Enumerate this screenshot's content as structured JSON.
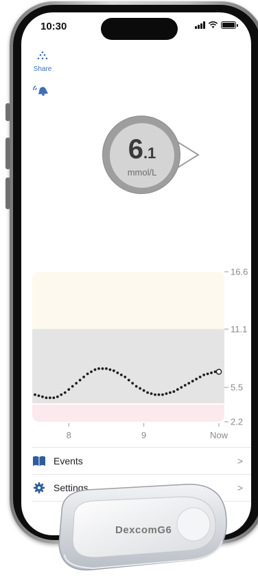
{
  "status": {
    "time": "10:30"
  },
  "share": {
    "label": "Share"
  },
  "reading": {
    "value_int": "6",
    "value_dec": ".1",
    "unit": "mmol/L",
    "trend": "steady"
  },
  "chart_data": {
    "type": "scatter",
    "title": "",
    "xlabel": "",
    "ylabel": "",
    "x_ticks": [
      "8",
      "9",
      "Now"
    ],
    "y_ticks": [
      2.2,
      5.5,
      11.1,
      16.6
    ],
    "y_lim": [
      2.2,
      16.6
    ],
    "bands": [
      {
        "name": "high",
        "from": 11.1,
        "to": 16.6,
        "color": "#fdf9ee"
      },
      {
        "name": "target",
        "from": 3.9,
        "to": 11.1,
        "color": "#e4e4e4"
      },
      {
        "name": "low",
        "from": 2.2,
        "to": 3.9,
        "color": "#fbe9ee"
      }
    ],
    "series": [
      {
        "x": [
          7.55,
          7.6,
          7.65,
          7.7,
          7.75,
          7.8,
          7.85,
          7.9,
          7.95,
          8.0,
          8.05,
          8.1,
          8.15,
          8.2,
          8.25,
          8.3,
          8.35,
          8.4,
          8.45,
          8.5,
          8.55,
          8.6,
          8.65,
          8.7,
          8.75,
          8.8,
          8.85,
          8.9,
          8.95,
          9.0,
          9.05,
          9.1,
          9.15,
          9.2,
          9.25,
          9.3,
          9.35,
          9.4,
          9.45,
          9.5,
          9.55,
          9.6,
          9.65,
          9.7,
          9.75,
          9.8,
          9.85,
          9.9,
          9.95,
          10.0
        ],
        "y": [
          4.8,
          4.7,
          4.6,
          4.5,
          4.5,
          4.5,
          4.6,
          4.8,
          5.0,
          5.3,
          5.6,
          5.9,
          6.2,
          6.5,
          6.8,
          7.0,
          7.2,
          7.3,
          7.3,
          7.3,
          7.2,
          7.1,
          6.9,
          6.7,
          6.5,
          6.2,
          5.9,
          5.6,
          5.4,
          5.2,
          5.0,
          4.9,
          4.8,
          4.8,
          4.8,
          4.9,
          5.0,
          5.1,
          5.3,
          5.5,
          5.7,
          5.9,
          6.1,
          6.3,
          6.5,
          6.7,
          6.8,
          6.9,
          7.0,
          7.0
        ]
      }
    ]
  },
  "menu": {
    "events": "Events",
    "settings": "Settings"
  },
  "sensor": {
    "brand": "DexcomG6"
  }
}
